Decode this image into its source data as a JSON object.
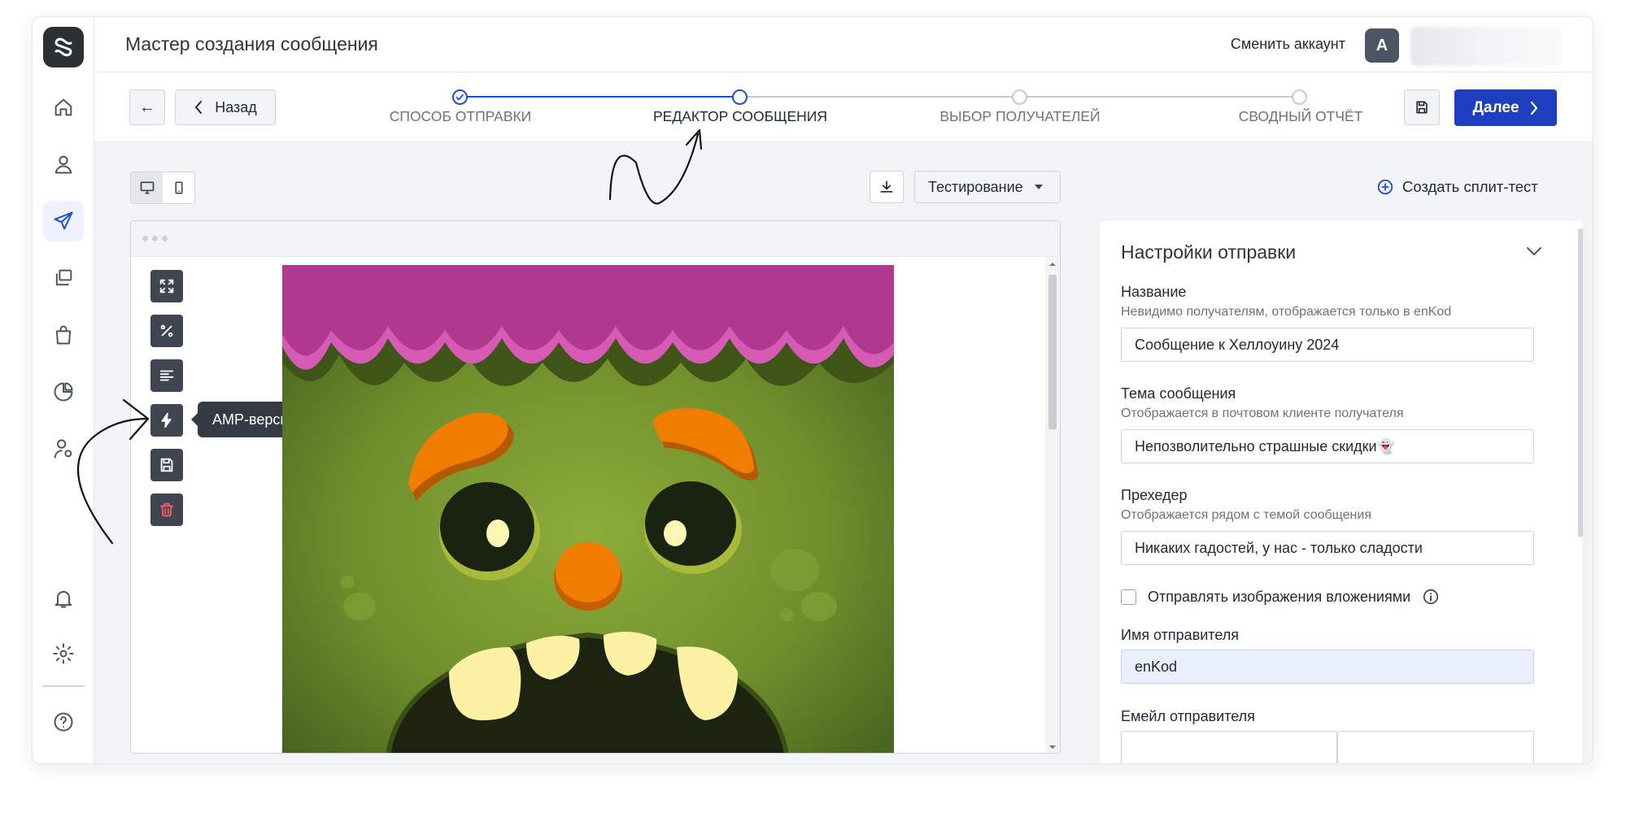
{
  "header": {
    "title": "Мастер создания сообщения",
    "switch_account": "Сменить аккаунт",
    "avatar_letter": "A"
  },
  "sidebar": {
    "items": [
      {
        "icon": "home-icon"
      },
      {
        "icon": "user-icon"
      },
      {
        "icon": "send-icon",
        "active": true
      },
      {
        "icon": "copy-icon"
      },
      {
        "icon": "shopping-bag-icon"
      },
      {
        "icon": "pie-chart-icon"
      },
      {
        "icon": "user-settings-icon"
      },
      {
        "icon": "bell-icon"
      },
      {
        "icon": "gear-icon"
      },
      {
        "icon": "help-icon"
      }
    ]
  },
  "wizard": {
    "back_arrow": "←",
    "back_label": "Назад",
    "steps": [
      {
        "label": "Способ отправки",
        "state": "done"
      },
      {
        "label": "Редактор сообщения",
        "state": "current"
      },
      {
        "label": "Выбор получателей",
        "state": "todo"
      },
      {
        "label": "Сводный отчёт",
        "state": "todo"
      }
    ],
    "next_label": "Далее"
  },
  "toolbar": {
    "test_label": "Тестирование",
    "split_test_label": "Создать сплит-тест"
  },
  "editor": {
    "tooltip": "AMP-версия",
    "tools": [
      "expand-icon",
      "percent-icon",
      "text-align-icon",
      "lightning-icon",
      "save-icon",
      "trash-icon"
    ]
  },
  "settings": {
    "title": "Настройки отправки",
    "name": {
      "label": "Название",
      "hint": "Невидимо получателям, отображается только в enKod",
      "value": "Сообщение к Хеллоуину 2024"
    },
    "subject": {
      "label": "Тема сообщения",
      "hint": "Отображается в почтовом клиенте получателя",
      "value": "Непозволительно страшные скидки👻"
    },
    "preheader": {
      "label": "Прехедер",
      "hint": "Отображается рядом с темой сообщения",
      "value": "Никаких гадостей, у нас - только сладости"
    },
    "attach_images_label": "Отправлять изображения вложениями",
    "sender_name": {
      "label": "Имя отправителя",
      "value": "enKod"
    },
    "sender_email": {
      "label": "Емейл отправителя"
    }
  },
  "colors": {
    "accent": "#1d3fbf",
    "monster_skin": "#6b8f2a",
    "monster_hair": "#b03a8f",
    "eyebrow": "#f07d00"
  }
}
